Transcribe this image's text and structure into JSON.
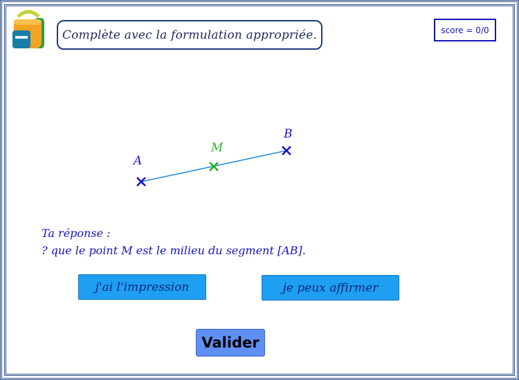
{
  "instruction": "Complète avec la formulation appropriée.",
  "score": "score = 0/0",
  "figure": {
    "points": [
      {
        "label": "A",
        "color": "#1414c8"
      },
      {
        "label": "M",
        "color": "#22b022"
      },
      {
        "label": "B",
        "color": "#1414c8"
      }
    ],
    "segment_color": "#2a8cdc"
  },
  "answer": {
    "label": "Ta réponse :",
    "sentence": "? que le point M est le milieu du segment [AB]."
  },
  "choices": [
    "j'ai l'impression",
    "je peux affirmer"
  ],
  "validate_label": "Valider"
}
